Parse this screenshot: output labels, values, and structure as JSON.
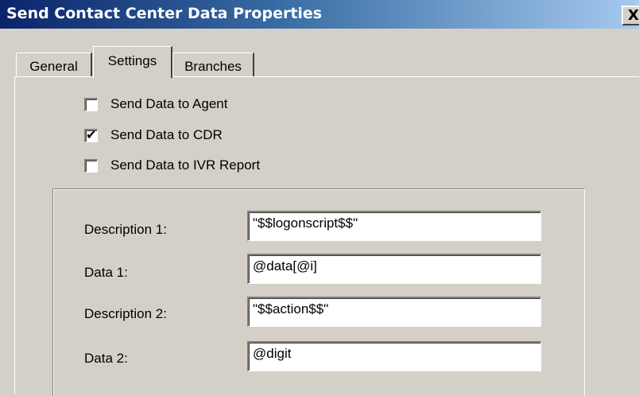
{
  "window": {
    "title": "Send Contact Center Data Properties",
    "close_glyph": "X"
  },
  "tabs": [
    {
      "label": "General",
      "selected": false
    },
    {
      "label": "Settings",
      "selected": true
    },
    {
      "label": "Branches",
      "selected": false
    }
  ],
  "checkboxes": [
    {
      "label": "Send Data to Agent",
      "checked": false
    },
    {
      "label": "Send Data to CDR",
      "checked": true
    },
    {
      "label": "Send Data to IVR Report",
      "checked": false
    }
  ],
  "check_mark": "✔",
  "fields": [
    {
      "label": "Description 1:",
      "value": "\"$$logonscript$$\""
    },
    {
      "label": "Data 1:",
      "value": "@data[@i]"
    },
    {
      "label": "Description 2:",
      "value": "\"$$action$$\""
    },
    {
      "label": "Data 2:",
      "value": "@digit"
    }
  ]
}
